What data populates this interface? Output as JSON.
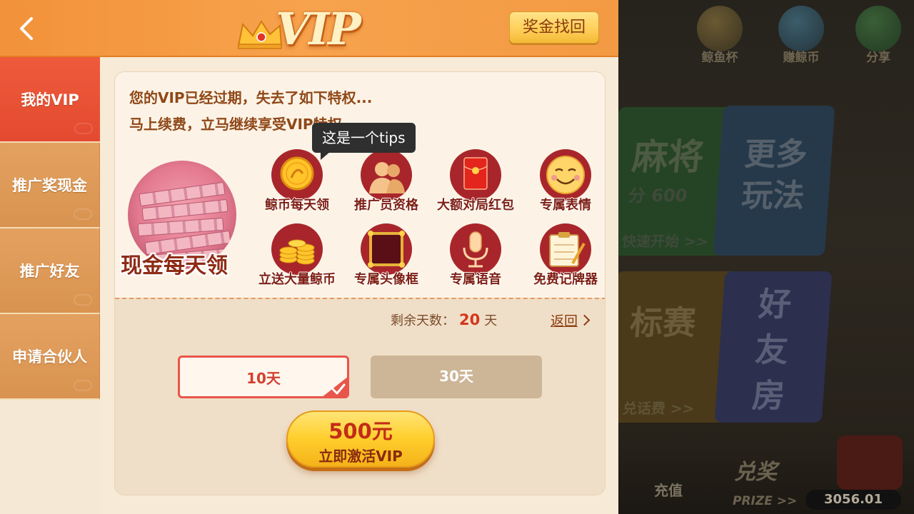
{
  "header": {
    "title": "VIP",
    "bonus_button": "奖金找回"
  },
  "sidebar": {
    "items": [
      {
        "label": "我的VIP"
      },
      {
        "label": "推广奖现金"
      },
      {
        "label": "推广好友"
      },
      {
        "label": "申请合伙人"
      }
    ]
  },
  "main": {
    "message_line1": "您的VIP已经过期，失去了如下特权...",
    "message_line2": "马上续费，立马继续享受VIP特权",
    "tooltip": "这是一个tips",
    "featured": {
      "label": "现金每天领"
    },
    "privileges": [
      {
        "label": "鲸币每天领",
        "icon": "gold-coin-icon"
      },
      {
        "label": "推广员资格",
        "icon": "people-icon"
      },
      {
        "label": "大额对局红包",
        "icon": "red-envelope-icon"
      },
      {
        "label": "专属表情",
        "icon": "smiley-face-icon"
      },
      {
        "label": "立送大量鲸币",
        "icon": "coin-stack-icon"
      },
      {
        "label": "专属头像框",
        "icon": "avatar-frame-icon"
      },
      {
        "label": "专属语音",
        "icon": "microphone-icon"
      },
      {
        "label": "免费记牌器",
        "icon": "card-counter-icon"
      }
    ],
    "remaining_label": "剩余天数：",
    "remaining_days": "20",
    "remaining_unit": "天",
    "return_link": "返回",
    "options": [
      {
        "label": "10天",
        "selected": true
      },
      {
        "label": "30天",
        "selected": false
      }
    ],
    "activate_price": "500元",
    "activate_label": "立即激活VIP"
  },
  "background": {
    "top_icons": [
      {
        "label": "鲸鱼杯",
        "icon": "trophy-icon"
      },
      {
        "label": "赚鲸币",
        "icon": "whale-icon"
      },
      {
        "label": "分享",
        "icon": "wechat-icon"
      }
    ],
    "cards": [
      {
        "title": "麻将",
        "sub": "分 600",
        "link": "快速开始 >>"
      },
      {
        "title": "更多玩法"
      },
      {
        "title": "标赛",
        "link": "兑话费 >>"
      },
      {
        "title": "好友房"
      }
    ],
    "recharge_label": "充值",
    "redeem_label": "兑奖",
    "prize_label": "PRIZE >>",
    "balance": "3056.01"
  },
  "colors": {
    "header_orange": "#f39a44",
    "active_tab": "#e44a2f",
    "inactive_tab": "#d99350",
    "accent_red": "#d4361c",
    "gold": "#ffcf2d"
  }
}
